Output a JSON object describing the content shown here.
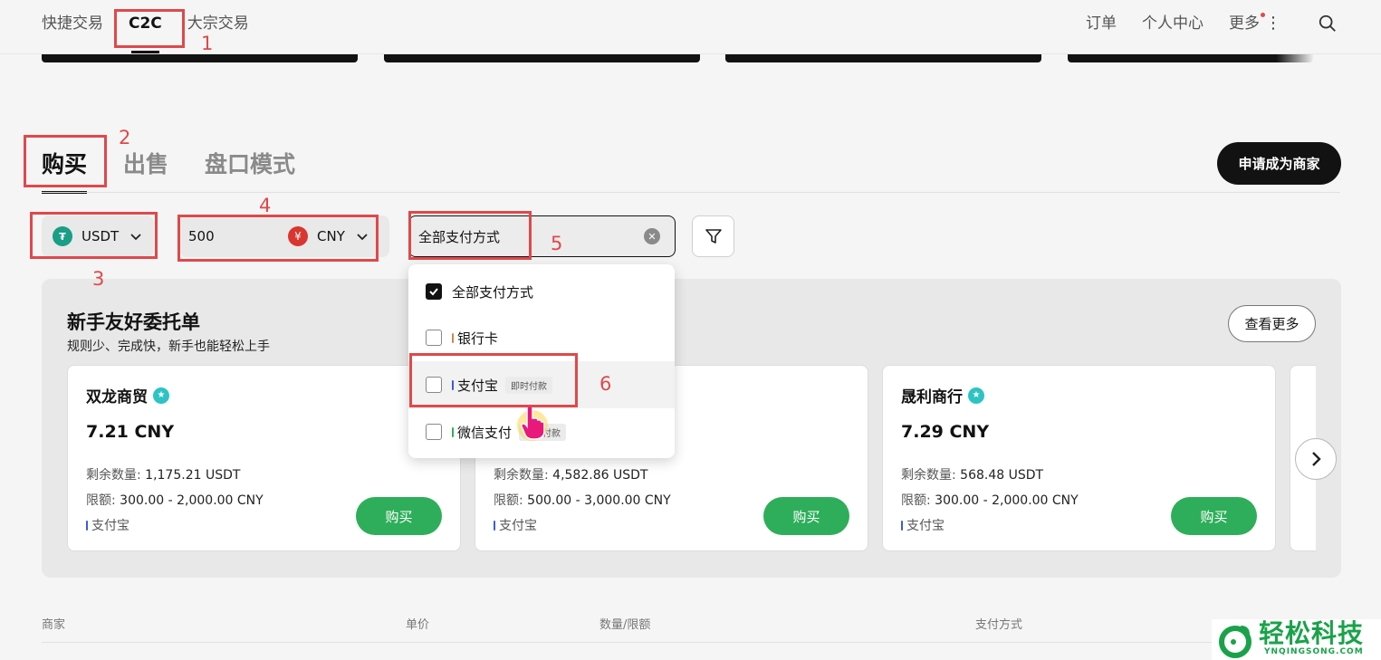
{
  "nav": {
    "left": [
      "快捷交易",
      "C2C",
      "大宗交易"
    ],
    "right": [
      "订单",
      "个人中心",
      "更多"
    ]
  },
  "tabs": [
    "购买",
    "出售",
    "盘口模式"
  ],
  "merchant_button": "申请成为商家",
  "filters": {
    "coin": "USDT",
    "amount": "500",
    "currency": "CNY",
    "payment": "全部支付方式"
  },
  "dropdown": {
    "options": [
      {
        "label": "全部支付方式",
        "checked": true,
        "badge": ""
      },
      {
        "label": "银行卡",
        "checked": false,
        "badge": ""
      },
      {
        "label": "支付宝",
        "checked": false,
        "badge": "即时付款"
      },
      {
        "label": "微信支付",
        "checked": false,
        "badge": "即时付款"
      }
    ]
  },
  "panel": {
    "title": "新手友好委托单",
    "subtitle": "规则少、完成快，新手也能轻松上手",
    "more": "查看更多",
    "cards": [
      {
        "name": "双龙商贸",
        "price": "7.21 CNY",
        "remaining_label": "剩余数量:",
        "remaining": "1,175.21 USDT",
        "limit_label": "限额:",
        "limit": "300.00 - 2,000.00 CNY",
        "pay": "支付宝",
        "buy": "购买"
      },
      {
        "name": "",
        "price": "",
        "remaining_label": "剩余数量:",
        "remaining": "4,582.86 USDT",
        "limit_label": "限额:",
        "limit": "500.00 - 3,000.00 CNY",
        "pay": "支付宝",
        "buy": "购买"
      },
      {
        "name": "晟利商行",
        "price": "7.29 CNY",
        "remaining_label": "剩余数量:",
        "remaining": "568.48 USDT",
        "limit_label": "限额:",
        "limit": "300.00 - 2,000.00 CNY",
        "pay": "支付宝",
        "buy": "购买"
      }
    ]
  },
  "table_headers": [
    "商家",
    "单价",
    "数量/限额",
    "支付方式"
  ],
  "annotations": [
    "1",
    "2",
    "3",
    "4",
    "5",
    "6"
  ],
  "watermark": {
    "text": "轻松科技",
    "sub": "YNQINGSONG.COM"
  },
  "colors": {
    "accent_green": "#2eae5a",
    "annotation_red": "#e0484a",
    "alipay_blue": "#3b5bdb",
    "bank_orange": "#c88a4a",
    "wechat_green": "#2eae5a"
  }
}
